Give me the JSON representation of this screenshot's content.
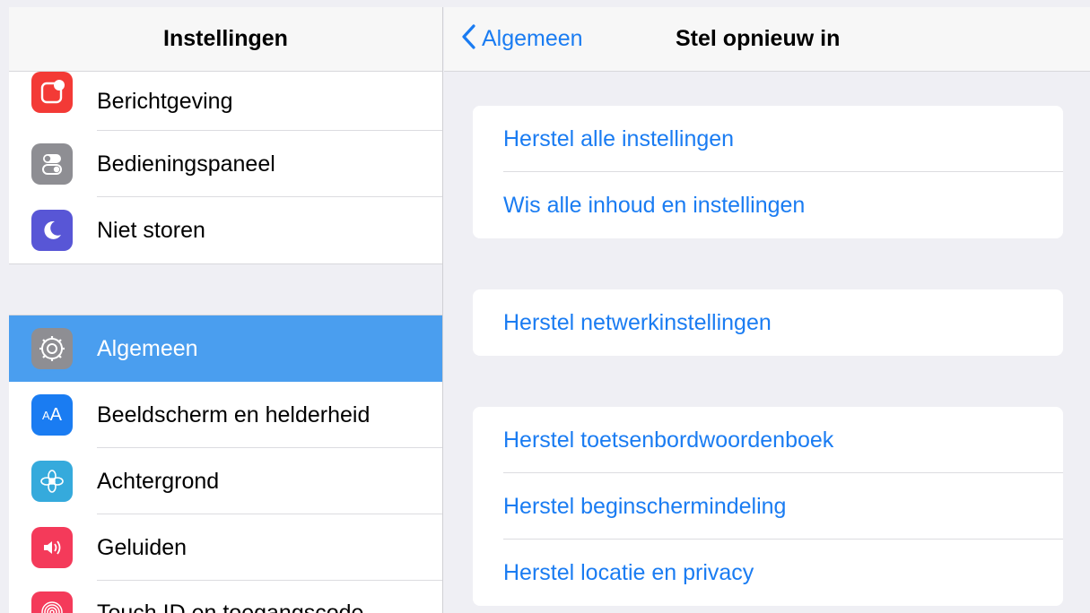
{
  "sidebar": {
    "title": "Instellingen",
    "group1": [
      {
        "label": "Berichtgeving",
        "icon": "notifications-icon",
        "color": "#f33a36"
      },
      {
        "label": "Bedieningspaneel",
        "icon": "control-center-icon",
        "color": "#8e8e93"
      },
      {
        "label": "Niet storen",
        "icon": "moon-icon",
        "color": "#5856d6"
      }
    ],
    "group2": [
      {
        "label": "Algemeen",
        "icon": "gear-icon",
        "color": "#8e8e93",
        "selected": true
      },
      {
        "label": "Beeldscherm en helderheid",
        "icon": "display-brightness-icon",
        "color": "#1a7cf2"
      },
      {
        "label": "Achtergrond",
        "icon": "wallpaper-flower-icon",
        "color": "#35aadc"
      },
      {
        "label": "Geluiden",
        "icon": "speaker-icon",
        "color": "#f43a5a"
      },
      {
        "label": "Touch ID en toegangscode",
        "icon": "fingerprint-icon",
        "color": "#f43a5a"
      }
    ]
  },
  "navbar": {
    "back_label": "Algemeen",
    "title": "Stel opnieuw in"
  },
  "reset": {
    "group1": [
      "Herstel alle instellingen",
      "Wis alle inhoud en instellingen"
    ],
    "group2": [
      "Herstel netwerkinstellingen"
    ],
    "group3": [
      "Herstel toetsenbordwoordenboek",
      "Herstel beginschermindeling",
      "Herstel locatie en privacy"
    ]
  },
  "colors": {
    "accent": "#1a7cf2",
    "selection": "#4a9eef",
    "background": "#efeff4"
  }
}
